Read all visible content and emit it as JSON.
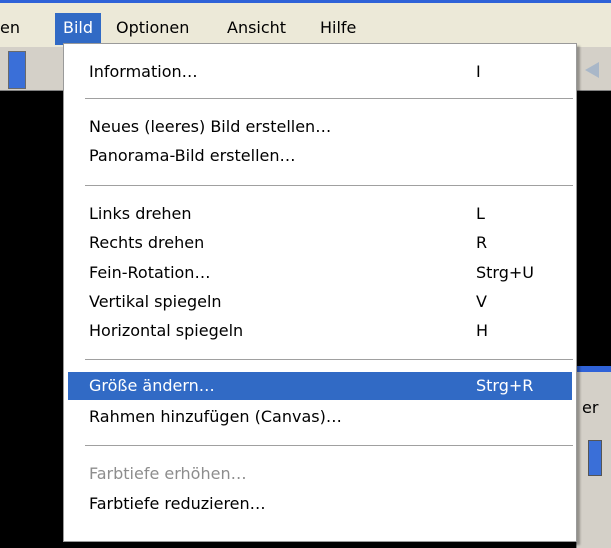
{
  "menubar": {
    "items": [
      {
        "label": "en"
      },
      {
        "label": "Bild"
      },
      {
        "label": "Optionen"
      },
      {
        "label": "Ansicht"
      },
      {
        "label": "Hilfe"
      }
    ]
  },
  "right_panel": {
    "text": "er"
  },
  "menu": {
    "items": [
      {
        "label": "Information…",
        "shortcut": "I"
      },
      {
        "label": "Neues (leeres) Bild erstellen…",
        "shortcut": ""
      },
      {
        "label": "Panorama-Bild erstellen…",
        "shortcut": ""
      },
      {
        "label": "Links drehen",
        "shortcut": "L"
      },
      {
        "label": "Rechts drehen",
        "shortcut": "R"
      },
      {
        "label": "Fein-Rotation…",
        "shortcut": "Strg+U"
      },
      {
        "label": "Vertikal spiegeln",
        "shortcut": "V"
      },
      {
        "label": "Horizontal spiegeln",
        "shortcut": "H"
      },
      {
        "label": "Größe ändern…",
        "shortcut": "Strg+R"
      },
      {
        "label": "Rahmen hinzufügen (Canvas)…",
        "shortcut": ""
      },
      {
        "label": "Farbtiefe erhöhen…",
        "shortcut": ""
      },
      {
        "label": "Farbtiefe reduzieren…",
        "shortcut": ""
      }
    ]
  }
}
